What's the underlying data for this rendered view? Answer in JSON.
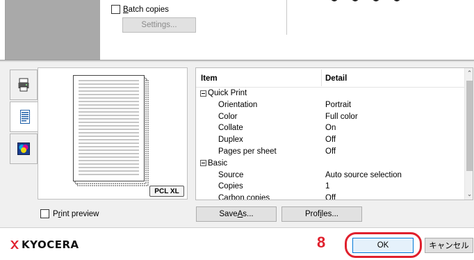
{
  "top": {
    "batch_label_underlined": "B",
    "batch_label_rest": "atch copies",
    "settings_label": "Settings..."
  },
  "tabs": [
    {
      "icon": "printer-icon"
    },
    {
      "icon": "document-icon"
    },
    {
      "icon": "color-palette-icon"
    }
  ],
  "preview": {
    "badge": "PCL XL",
    "print_preview_pre": "P",
    "print_preview_underlined": "r",
    "print_preview_post": "int preview"
  },
  "table": {
    "headers": {
      "item": "Item",
      "detail": "Detail"
    },
    "rows": [
      {
        "item": "Quick Print",
        "detail": "",
        "group": true
      },
      {
        "item": "Orientation",
        "detail": "Portrait"
      },
      {
        "item": "Color",
        "detail": "Full color"
      },
      {
        "item": "Collate",
        "detail": "On"
      },
      {
        "item": "Duplex",
        "detail": "Off"
      },
      {
        "item": "Pages per sheet",
        "detail": "Off"
      },
      {
        "item": "Basic",
        "detail": "",
        "group": true
      },
      {
        "item": "Source",
        "detail": "Auto source selection"
      },
      {
        "item": "Copies",
        "detail": "1"
      },
      {
        "item": "Carbon copies",
        "detail": "Off"
      }
    ]
  },
  "buttons": {
    "save_as_pre": "Save ",
    "save_as_underlined": "A",
    "save_as_post": "s...",
    "profiles_pre": "Prof",
    "profiles_underlined": "i",
    "profiles_post": "les...",
    "ok": "OK",
    "cancel": "キャンセル"
  },
  "footer": {
    "brand": "KYOCERA",
    "step_number": "8"
  },
  "colors": {
    "highlight_red": "#e0202d",
    "ok_border": "#0078d7"
  }
}
